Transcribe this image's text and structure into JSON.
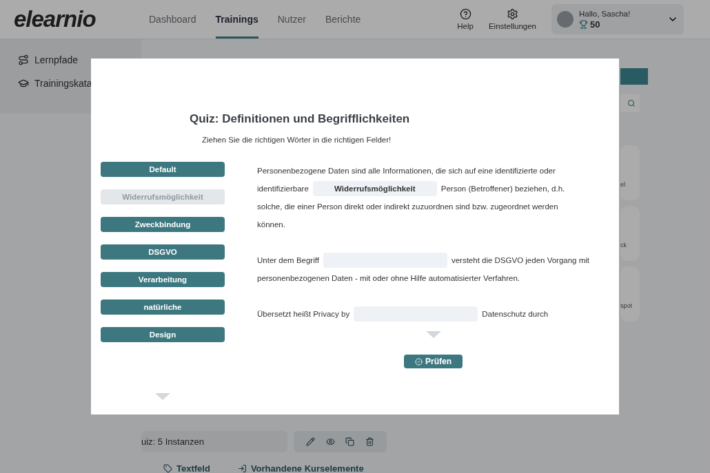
{
  "header": {
    "logo": "elearnio",
    "nav": [
      {
        "label": "Dashboard",
        "selected": false
      },
      {
        "label": "Trainings",
        "selected": true
      },
      {
        "label": "Nutzer",
        "selected": false
      },
      {
        "label": "Berichte",
        "selected": false
      }
    ],
    "help": "Help",
    "settings": "Einstellungen",
    "user": {
      "greeting": "Hallo, Sascha!",
      "points": "50"
    }
  },
  "sidebar": {
    "items": [
      {
        "label": "Lernpfade",
        "kind": "path"
      },
      {
        "label": "Trainingskata",
        "kind": "catalog"
      }
    ]
  },
  "background": {
    "instances": "uiz: 5 Instanzen",
    "links": [
      {
        "label": "Textfeld",
        "kind": "tag"
      },
      {
        "label": "Vorhandene Kurselemente",
        "kind": "import"
      }
    ],
    "cards": [
      "el",
      "ck",
      "spot"
    ]
  },
  "modal": {
    "title": "Quiz: Definitionen und Begrifflichkeiten",
    "instruction": "Ziehen Sie die richtigen Wörter in die richtigen Felder!",
    "words": [
      {
        "label": "Default",
        "used": false
      },
      {
        "label": "Widerrufsmöglichkeit",
        "used": true
      },
      {
        "label": "Zweckbindung",
        "used": false
      },
      {
        "label": "DSGVO",
        "used": false
      },
      {
        "label": "Verarbeitung",
        "used": false
      },
      {
        "label": "natürliche",
        "used": false
      },
      {
        "label": "Design",
        "used": false
      }
    ],
    "paragraphs": [
      [
        [
          {
            "kind": "text",
            "text": "Personenbezogene Daten sind alle Informationen, die sich auf eine identifizierte oder"
          }
        ],
        [
          {
            "kind": "text",
            "text": "identifizierbare"
          },
          {
            "kind": "blank",
            "value": "Widerrufsmöglichkeit"
          },
          {
            "kind": "text",
            "text": "Person (Betroffener) beziehen, d.h."
          }
        ],
        [
          {
            "kind": "text",
            "text": "solche, die einer Person direkt oder indirekt zuzuordnen sind bzw. zugeordnet werden"
          }
        ],
        [
          {
            "kind": "text",
            "text": "können."
          }
        ]
      ],
      [
        [
          {
            "kind": "text",
            "text": "Unter dem Begriff"
          },
          {
            "kind": "blank"
          },
          {
            "kind": "text",
            "text": "versteht die DSGVO jeden Vorgang mit"
          }
        ],
        [
          {
            "kind": "text",
            "text": "personenbezogenen Daten - mit oder ohne Hilfe automatisierter Verfahren."
          }
        ]
      ],
      [
        [
          {
            "kind": "text",
            "text": "Übersetzt heißt Privacy by"
          },
          {
            "kind": "blank"
          },
          {
            "kind": "text",
            "text": "Datenschutz durch"
          }
        ]
      ]
    ],
    "check_button": "Prüfen"
  }
}
